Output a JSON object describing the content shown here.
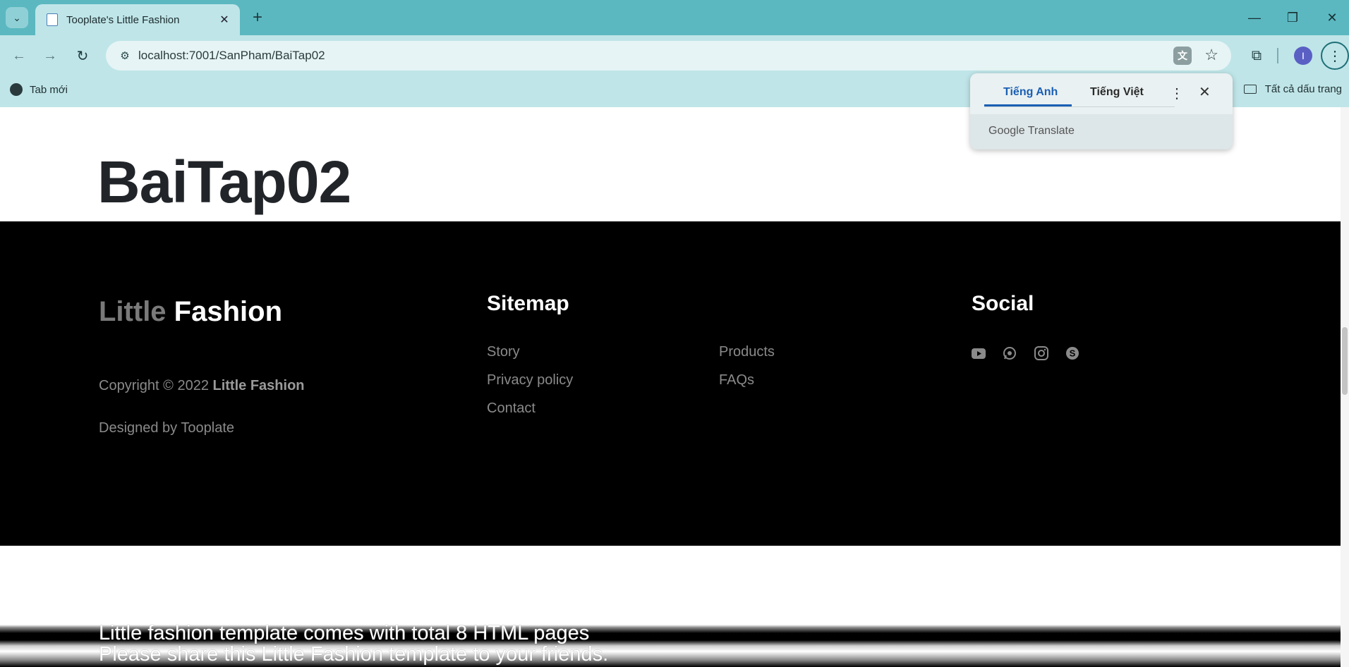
{
  "browser": {
    "tab_title": "Tooplate's Little Fashion",
    "url": "localhost:7001/SanPham/BaiTap02",
    "bookmark_label": "Tab mới",
    "all_bookmarks_label": "Tất cả dấu trang",
    "profile_initial": "I"
  },
  "translate_popup": {
    "lang_source": "Tiếng Anh",
    "lang_target": "Tiếng Việt",
    "brand": "Google Translate"
  },
  "page": {
    "heading": "BaiTap02"
  },
  "footer": {
    "brand_light": "Little",
    "brand_bold": "Fashion",
    "copyright_prefix": "Copyright © 2022",
    "copyright_brand": "Little Fashion",
    "designed_by": "Designed by Tooplate",
    "sitemap_title": "Sitemap",
    "sitemap_col1": [
      "Story",
      "Privacy policy",
      "Contact"
    ],
    "sitemap_col2": [
      "Products",
      "FAQs"
    ],
    "social_title": "Social",
    "social_icons": [
      "youtube-icon",
      "whatsapp-icon",
      "instagram-icon",
      "skype-icon"
    ]
  },
  "overlay_text": {
    "line1": "Little fashion template comes with total 8 HTML pages",
    "line2": "Please share this Little Fashion template to your friends."
  }
}
